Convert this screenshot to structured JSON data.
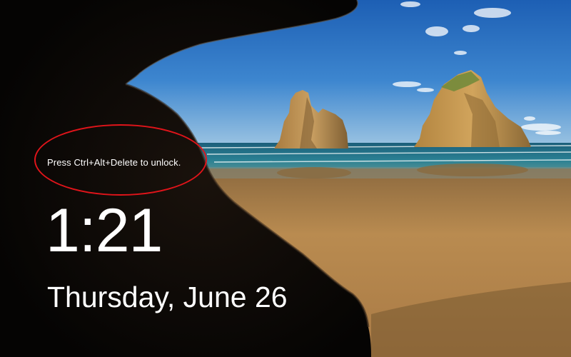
{
  "lock_screen": {
    "unlock_hint": "Press Ctrl+Alt+Delete to unlock.",
    "time": "1:21",
    "date": "Thursday, June 26"
  },
  "colors": {
    "text": "#ffffff",
    "highlight_ring": "#e0141a",
    "sky": "#2f74c6",
    "sea": "#1f6f86",
    "sand": "#b88a4f",
    "cave": "#0b0806"
  },
  "icons": []
}
